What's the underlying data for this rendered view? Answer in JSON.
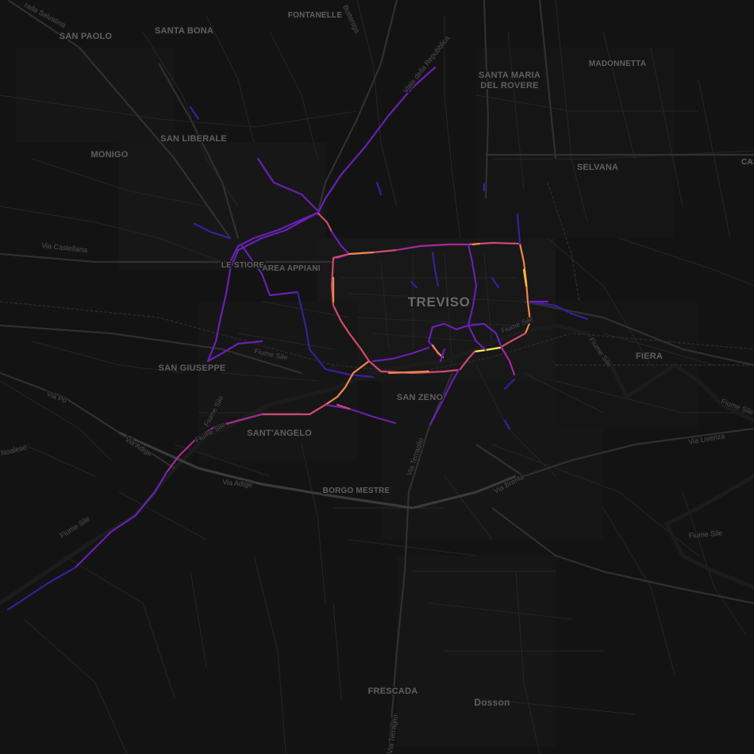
{
  "map": {
    "theme": "dark",
    "background_color": "#121212",
    "city_label": "TREVISO",
    "district_labels": [
      {
        "id": "san-paolo",
        "text": "SAN PAOLO"
      },
      {
        "id": "santa-bona",
        "text": "SANTA BONA"
      },
      {
        "id": "fontanelle",
        "text": "FONTANELLE"
      },
      {
        "id": "santa-maria-1",
        "text": "SANTA MARIA"
      },
      {
        "id": "santa-maria-2",
        "text": "DEL ROVERE"
      },
      {
        "id": "madonnetta",
        "text": "MADONNETTA"
      },
      {
        "id": "monigo",
        "text": "MONIGO"
      },
      {
        "id": "san-liberale",
        "text": "SAN LIBERALE"
      },
      {
        "id": "selvana",
        "text": "SELVANA"
      },
      {
        "id": "le-stiore",
        "text": "LE STIORE"
      },
      {
        "id": "area-appiani",
        "text": "AREA APPIANI"
      },
      {
        "id": "fiera",
        "text": "FIERA"
      },
      {
        "id": "san-giuseppe",
        "text": "SAN GIUSEPPE"
      },
      {
        "id": "san-zeno",
        "text": "SAN ZENO"
      },
      {
        "id": "santangelo",
        "text": "SANT'ANGELO"
      },
      {
        "id": "borgo-mestre",
        "text": "BORGO MESTRE"
      },
      {
        "id": "frescada",
        "text": "FRESCADA"
      },
      {
        "id": "dosson",
        "text": "Dosson"
      },
      {
        "id": "cas",
        "text": "CAS"
      }
    ],
    "street_labels": [
      {
        "id": "strada-selvatina",
        "text": "rada Selvatina"
      },
      {
        "id": "botteniga",
        "text": "Botteniga"
      },
      {
        "id": "viale-repubblica",
        "text": "Viale della Repubblica"
      },
      {
        "id": "via-castellana",
        "text": "Via Castellana"
      },
      {
        "id": "fiume-sile-1",
        "text": "Fiume Sile"
      },
      {
        "id": "fiume-sile-2",
        "text": "Fiume Sile"
      },
      {
        "id": "fiume-sile-3",
        "text": "Fiume Sile"
      },
      {
        "id": "fiume-sile-4",
        "text": "Fiume Sile"
      },
      {
        "id": "fiume-sile-5",
        "text": "Fiume Sile"
      },
      {
        "id": "fiume-sile-6",
        "text": "Fiume Sile"
      },
      {
        "id": "fiume-sile-7",
        "text": "Fiume Sile"
      },
      {
        "id": "fiume-sile-8",
        "text": "Fiume Sile"
      },
      {
        "id": "via-po",
        "text": "Via Po"
      },
      {
        "id": "via-noalese",
        "text": "Noalese"
      },
      {
        "id": "via-adige-1",
        "text": "Via Adige"
      },
      {
        "id": "via-adige-2",
        "text": "Via Adige"
      },
      {
        "id": "via-terraglio-1",
        "text": "Via Terraglio"
      },
      {
        "id": "via-terraglio-2",
        "text": "Via Terraglio"
      },
      {
        "id": "via-brenta",
        "text": "Via Brenta"
      },
      {
        "id": "via-livenza",
        "text": "Via Livenza"
      }
    ],
    "traffic_colors": {
      "low": "#3a1f9a",
      "medium_low": "#6a1fb5",
      "medium": "#a3299b",
      "medium_high": "#d04a6e",
      "high": "#f0854a",
      "very_high": "#f3c53c",
      "peak": "#f4f04a"
    }
  }
}
